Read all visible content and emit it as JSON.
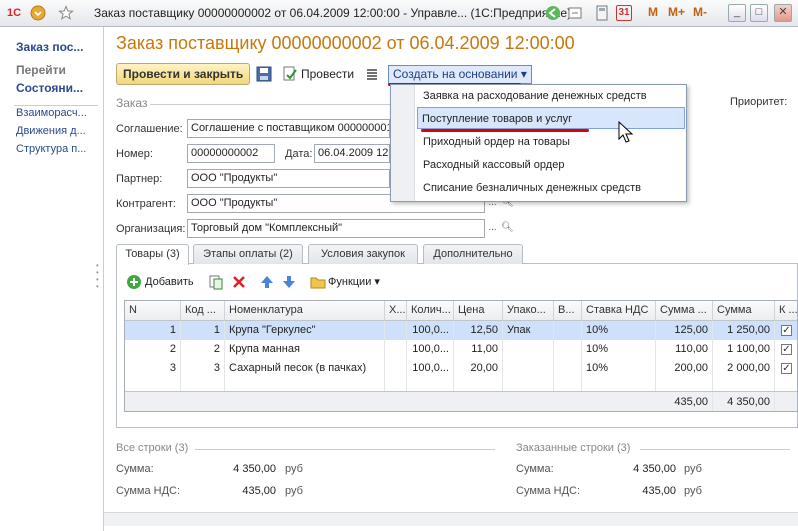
{
  "titlebar": {
    "title": "Заказ поставщику 00000000002 от 06.04.2009 12:00:00 - Управле...  (1С:Предприятие)",
    "logo_text": "1С",
    "m_buttons": [
      "M",
      "M+",
      "M-"
    ],
    "calendar_text": "31",
    "minimize": "_",
    "restore": "□",
    "close": "✕"
  },
  "left_panel": {
    "doc_link": "Заказ пос...",
    "section": "Перейти",
    "items": [
      "Состояни...",
      "Взаиморасч...",
      "Движения д...",
      "Структура п..."
    ]
  },
  "doc": {
    "title": "Заказ поставщику 00000000002 от 06.04.2009 12:00:00",
    "buttons": {
      "post_close": "Провести и закрыть",
      "post": "Провести",
      "create_based": "Создать на основании"
    },
    "priority_label": "Приоритет:",
    "group_order": "Заказ",
    "fields": {
      "agreement_label": "Соглашение:",
      "agreement_value": "Соглашение с поставщиком 000000001",
      "number_label": "Номер:",
      "number_value": "00000000002",
      "date_label": "Дата:",
      "date_value": "06.04.2009 12",
      "partner_label": "Партнер:",
      "partner_value": "ООО \"Продукты\"",
      "counterparty_label": "Контрагент:",
      "counterparty_value": "ООО \"Продукты\"",
      "org_label": "Организация:",
      "org_value": "Торговый дом \"Комплексный\""
    }
  },
  "tabs": [
    "Товары (3)",
    "Этапы оплаты (2)",
    "Условия закупок",
    "Дополнительно"
  ],
  "grid_toolbar": {
    "add": "Добавить",
    "functions": "Функции"
  },
  "grid": {
    "headers": [
      "N",
      "Код ...",
      "Номенклатура",
      "Х...",
      "Колич...",
      "Цена",
      "Упако...",
      "В...",
      "Ставка НДС",
      "Сумма ...",
      "Сумма",
      "К ..."
    ],
    "rows": [
      {
        "n": "1",
        "code": "1",
        "name": "Крупа \"Геркулес\"",
        "qty": "100,0...",
        "price": "12,50",
        "pack": "Упак",
        "vat": "10%",
        "vat_sum": "125,00",
        "sum": "1 250,00",
        "check": "✓"
      },
      {
        "n": "2",
        "code": "2",
        "name": "Крупа манная",
        "qty": "100,0...",
        "price": "11,00",
        "pack": "",
        "vat": "10%",
        "vat_sum": "110,00",
        "sum": "1 100,00",
        "check": "✓"
      },
      {
        "n": "3",
        "code": "3",
        "name": "Сахарный песок (в пачках)",
        "qty": "100,0...",
        "price": "20,00",
        "pack": "",
        "vat": "10%",
        "vat_sum": "200,00",
        "sum": "2 000,00",
        "check": "✓"
      }
    ],
    "footer": {
      "vat_sum": "435,00",
      "sum": "4 350,00"
    }
  },
  "totals": {
    "all_rows_label": "Все строки (3)",
    "ordered_rows_label": "Заказанные строки (3)",
    "sum_label": "Сумма:",
    "vat_label": "Сумма НДС:",
    "all_sum": "4 350,00",
    "all_vat": "435,00",
    "ordered_sum": "4 350,00",
    "ordered_vat": "435,00",
    "currency": "руб"
  },
  "menu": {
    "items": [
      "Заявка на расходование денежных средств",
      "Поступление товаров и услуг",
      "Приходный ордер на товары",
      "Расходный кассовый ордер",
      "Списание безналичных денежных средств"
    ]
  },
  "colors": {
    "accent_title": "#c8780a",
    "highlight": "#d8e6fb",
    "underline_red": "#e00000",
    "link": "#2a4a8c"
  }
}
